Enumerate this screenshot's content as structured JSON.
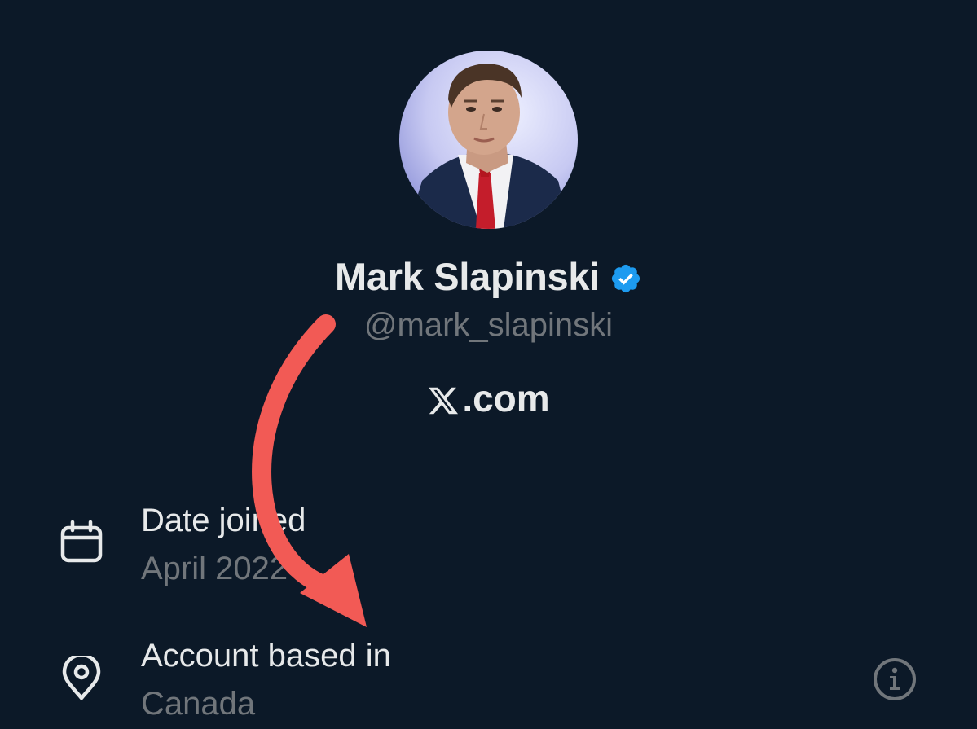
{
  "profile": {
    "display_name": "Mark Slapinski",
    "handle": "@mark_slapinski",
    "verified": true,
    "connected_via": ".com"
  },
  "details": [
    {
      "title": "Date joined",
      "value": "April 2022",
      "icon": "calendar-icon"
    },
    {
      "title": "Account based in",
      "value": "Canada",
      "icon": "location-pin-icon"
    }
  ],
  "colors": {
    "background": "#0c1928",
    "primary_text": "#e7e9ea",
    "secondary_text": "#71767b",
    "verified_badge": "#1d9bf0",
    "annotation_arrow": "#f25a55"
  }
}
